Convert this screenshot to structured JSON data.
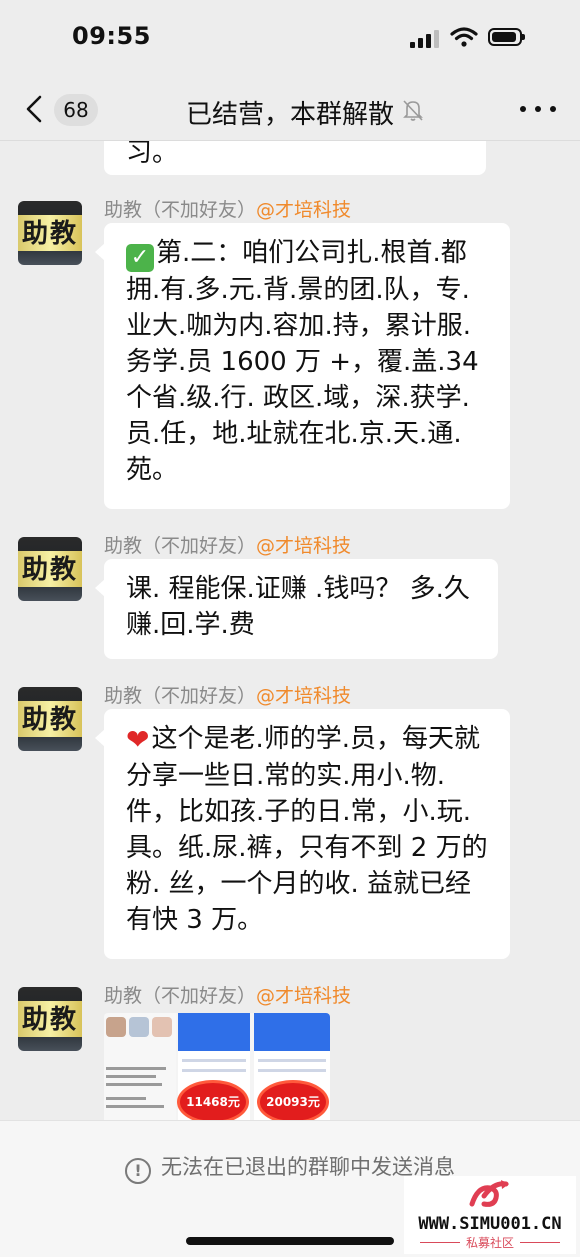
{
  "status_bar": {
    "time": "09:55"
  },
  "nav": {
    "unread_count": "68",
    "title": "已结营，本群解散"
  },
  "messages": [
    {
      "text": "习。"
    },
    {
      "sender": "助教（不加好友）",
      "group_tag": "@才培科技",
      "avatar_text": "助教",
      "text": "第.二：咱们公司扎.根首.都拥.有.多.元.背.景的团.队，专.业大.咖为内.容加.持，累计服.务学.员 1600 万 +，覆.盖.34 个省.级.行. 政区.域，深.获学.员.任，地.址就在北.京.天.通.苑。"
    },
    {
      "sender": "助教（不加好友）",
      "group_tag": "@才培科技",
      "avatar_text": "助教",
      "text": "课. 程能保.证赚 .钱吗？ 多.久赚.回.学.费"
    },
    {
      "sender": "助教（不加好友）",
      "group_tag": "@才培科技",
      "avatar_text": "助教",
      "text": "这个是老.师的学.员，每天就分享一些日.常的实.用小.物.件，比如孩.子的日.常，小.玩.具。纸.尿.裤，只有不到 2 万的粉. 丝，一个月的收. 益就已经有快 3 万。"
    },
    {
      "sender": "助教（不加好友）",
      "group_tag": "@才培科技",
      "avatar_text": "助教",
      "image_labels": [
        "11468元",
        "20093元"
      ]
    }
  ],
  "footer": {
    "notice": "无法在已退出的群聊中发送消息"
  },
  "watermark": {
    "url": "WWW.SIMU001.CN",
    "subtitle": "私募社区"
  },
  "colors": {
    "group_tag": "#f08a2c",
    "background": "#ededed",
    "bubble": "#ffffff"
  }
}
